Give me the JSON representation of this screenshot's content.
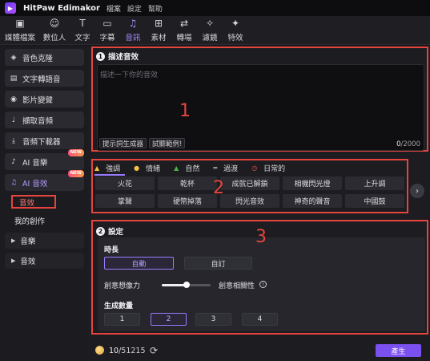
{
  "titlebar": {
    "app_name": "HitPaw Edimakor",
    "menus": [
      "檔案",
      "設定",
      "幫助"
    ]
  },
  "toolbar": {
    "items": [
      {
        "label": "媒體檔案",
        "icon": "media-icon"
      },
      {
        "label": "數位人",
        "icon": "avatar-icon"
      },
      {
        "label": "文字",
        "icon": "text-icon"
      },
      {
        "label": "字幕",
        "icon": "subtitle-icon"
      },
      {
        "label": "音訊",
        "icon": "music-note-icon",
        "active": true
      },
      {
        "label": "素材",
        "icon": "assets-icon"
      },
      {
        "label": "轉場",
        "icon": "transition-icon"
      },
      {
        "label": "濾鏡",
        "icon": "filter-icon"
      },
      {
        "label": "特效",
        "icon": "effects-icon"
      }
    ]
  },
  "sidebar": {
    "items": [
      {
        "label": "音色克隆",
        "icon": "voice-clone-icon"
      },
      {
        "label": "文字轉語音",
        "icon": "text-to-speech-icon"
      },
      {
        "label": "影片變聲",
        "icon": "voice-changer-icon"
      },
      {
        "label": "擷取音頻",
        "icon": "microphone-icon"
      },
      {
        "label": "音頻下載器",
        "icon": "download-icon"
      },
      {
        "label": "AI 音樂",
        "icon": "ai-music-icon",
        "badge": "NEW"
      },
      {
        "label": "AI 音效",
        "icon": "ai-sound-effect-icon",
        "badge": "NEW",
        "active": true
      }
    ],
    "sub_items": [
      {
        "label": "音效",
        "selected": true
      },
      {
        "label": "我的創作"
      }
    ],
    "folders": [
      {
        "label": "音樂"
      },
      {
        "label": "音效"
      }
    ]
  },
  "section1": {
    "number": "1",
    "title": "描述音效",
    "placeholder": "描述一下你的音效",
    "prompt_button": "提示詞生成器",
    "example_button": "試聽範例!",
    "char_current": "0",
    "char_max": "/2000",
    "annotation": "1"
  },
  "section2": {
    "tabs": [
      {
        "label": "強調",
        "icon": "emphasis-icon",
        "active": true
      },
      {
        "label": "情緒",
        "icon": "emotion-icon"
      },
      {
        "label": "自然",
        "icon": "nature-icon"
      },
      {
        "label": "過渡",
        "icon": "transition-icon"
      },
      {
        "label": "日常的",
        "icon": "clock-icon"
      }
    ],
    "chips": [
      "火花",
      "乾杯",
      "成就已解鎖",
      "相機閃光燈",
      "上升調",
      "掌聲",
      "硬幣掉落",
      "閃光音效",
      "神奇的聲音",
      "中國鼓"
    ],
    "annotation": "2"
  },
  "section3": {
    "number": "2",
    "title": "設定",
    "duration_label": "時長",
    "duration_options": [
      "自動",
      "自訂"
    ],
    "duration_selected": 0,
    "creativity_label": "創意想像力",
    "relevance_label": "創意相關性",
    "slider_value": 0.5,
    "count_label": "生成數量",
    "count_options": [
      "1",
      "2",
      "3",
      "4"
    ],
    "count_selected": 1,
    "annotation": "3"
  },
  "bottombar": {
    "credits_current": "10",
    "credits_total": "/51215",
    "generate_label": "產生"
  },
  "colors": {
    "accent": "#7b50f0",
    "highlight_box": "#e5453d",
    "background": "#1c1c21"
  }
}
